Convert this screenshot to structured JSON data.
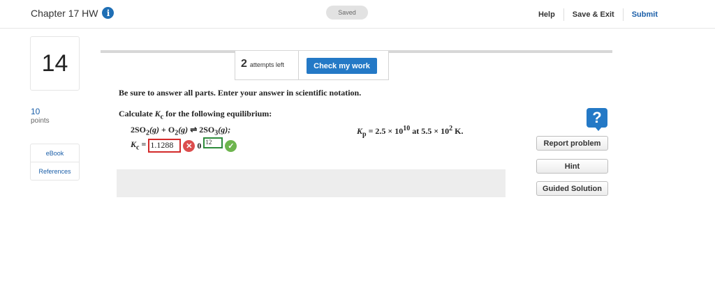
{
  "header": {
    "title": "Chapter 17 HW",
    "info_icon": "i",
    "saved": "Saved",
    "help": "Help",
    "save_exit": "Save & Exit",
    "submit": "Submit"
  },
  "left": {
    "question_number": "14",
    "points_value": "10",
    "points_label": "points",
    "resources": [
      "eBook",
      "References"
    ]
  },
  "attempts": {
    "count": "2",
    "label": "attempts left",
    "check_button": "Check my work"
  },
  "question": {
    "instruction": "Be sure to answer all parts. Enter your answer in scientific notation.",
    "calc_prefix": "Calculate ",
    "calc_k": "K",
    "calc_k_sub": "c",
    "calc_suffix": " for the following equilibrium:",
    "eq_coef1": "2SO",
    "eq_sub1": "2",
    "eq_state1": "(g)",
    "eq_plus": " + O",
    "eq_sub2": "2",
    "eq_state2": "(g)",
    "eq_arrow": " ⇌ ",
    "eq_coef3": "2SO",
    "eq_sub3": "3",
    "eq_state3": "(g);",
    "kp_k": "K",
    "kp_sub": "p",
    "kp_mid": " = 2.5 × 10",
    "kp_exp": "10",
    "kp_at": " at 5.5 × 10",
    "kp_exp2": "2",
    "kp_unit": " K.",
    "kc_k": "K",
    "kc_sub": "c",
    "kc_eq": " =",
    "mantissa": "1.1288",
    "wrong_icon": "✕",
    "times": "0",
    "exponent": "12",
    "correct_icon": "✓"
  },
  "sidebar": {
    "help_icon": "?",
    "report": "Report problem",
    "hint": "Hint",
    "guided": "Guided Solution"
  }
}
